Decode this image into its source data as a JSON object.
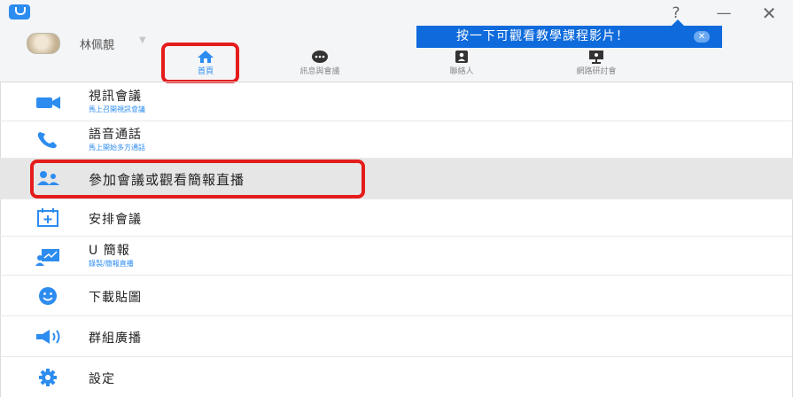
{
  "window": {
    "help_label": "?",
    "minimize_label": "—",
    "close_label": "✕"
  },
  "user": {
    "name": "林佩靚",
    "caret": "▼"
  },
  "tooltip": {
    "text": "按一下可觀看教學課程影片！",
    "close": "✕"
  },
  "tabs": [
    {
      "label": "首頁",
      "icon": "home-icon",
      "active": true
    },
    {
      "label": "訊息與會議",
      "icon": "chat-icon",
      "active": false
    },
    {
      "label": "聯絡人",
      "icon": "contacts-icon",
      "active": false
    },
    {
      "label": "網路研討會",
      "icon": "webinar-icon",
      "active": false
    }
  ],
  "menu": [
    {
      "title": "視訊會議",
      "subtitle": "馬上召開視訊會議",
      "icon": "video-camera-icon"
    },
    {
      "title": "語音通話",
      "subtitle": "馬上開始多方通話",
      "icon": "phone-icon"
    },
    {
      "title": "參加會議或觀看簡報直播",
      "subtitle": "",
      "icon": "group-icon"
    },
    {
      "title": "安排會議",
      "subtitle": "",
      "icon": "calendar-add-icon"
    },
    {
      "title": "U 簡報",
      "subtitle": "錄製/簡報直播",
      "icon": "presentation-icon"
    },
    {
      "title": "下載貼圖",
      "subtitle": "",
      "icon": "smiley-icon"
    },
    {
      "title": "群組廣播",
      "subtitle": "",
      "icon": "broadcast-icon"
    },
    {
      "title": "設定",
      "subtitle": "",
      "icon": "gear-icon"
    }
  ],
  "colors": {
    "accent": "#2d8cf0",
    "highlight": "#e51c1c",
    "tooltip_bg": "#0f6bdc",
    "selected_row": "#e6e6e6"
  }
}
